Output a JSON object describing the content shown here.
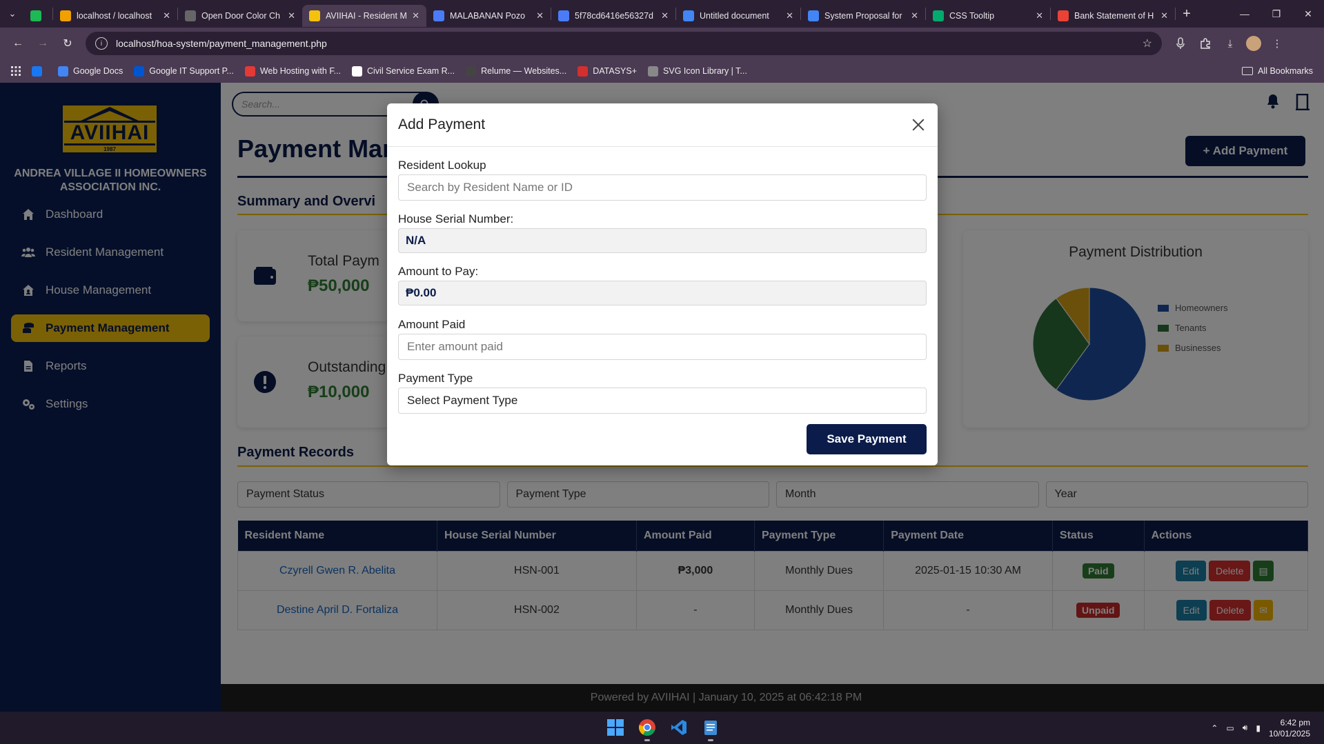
{
  "browser": {
    "tabs": [
      {
        "title": "",
        "favicon": "spotify-icon",
        "pinned": true,
        "color": "#1DB954"
      },
      {
        "title": "localhost / localhost",
        "favicon": "phpmyadmin-icon",
        "color": "#f0a000"
      },
      {
        "title": "Open Door Color Ch",
        "favicon": "globe-icon",
        "color": "#666666"
      },
      {
        "title": "AVIIHAI - Resident M",
        "favicon": "aviihai-icon",
        "color": "#f4c20d",
        "active": true
      },
      {
        "title": "MALABANAN Pozo",
        "favicon": "messenger-icon",
        "color": "#4a7cf7"
      },
      {
        "title": "5f78cd6416e56327d",
        "favicon": "cloud-icon",
        "color": "#4a7cf7"
      },
      {
        "title": "Untitled document",
        "favicon": "docs-icon",
        "color": "#4285f4"
      },
      {
        "title": "System Proposal for",
        "favicon": "docs-icon",
        "color": "#4285f4"
      },
      {
        "title": "CSS Tooltip",
        "favicon": "w3-icon",
        "color": "#04aa6d"
      },
      {
        "title": "Bank Statement of H",
        "favicon": "gmail-icon",
        "color": "#ea4335"
      }
    ],
    "url": "localhost/hoa-system/payment_management.php",
    "bookmarks": [
      {
        "label": "",
        "icon": "facebook-icon",
        "color": "#1877f2"
      },
      {
        "label": "Google Docs",
        "icon": "docs-icon",
        "color": "#4285f4"
      },
      {
        "label": "Google IT Support P...",
        "icon": "coursera-icon",
        "color": "#0056d2"
      },
      {
        "label": "Web Hosting with F...",
        "icon": "zeta-icon",
        "color": "#e53935"
      },
      {
        "label": "Civil Service Exam R...",
        "icon": "flag-icon",
        "color": "#ffffff"
      },
      {
        "label": "Relume — Websites...",
        "icon": "relume-icon",
        "color": "#444444"
      },
      {
        "label": "DATASYS+",
        "icon": "datasys-icon",
        "color": "#d32f2f"
      },
      {
        "label": "SVG Icon Library | T...",
        "icon": "svg-icon",
        "color": "#888888"
      }
    ],
    "all_bookmarks": "All Bookmarks"
  },
  "sidebar": {
    "logo_text": "AVIIHAI",
    "logo_year": "1987",
    "org_name": "ANDREA VILLAGE II HOMEOWNERS ASSOCIATION INC.",
    "items": [
      {
        "label": "Dashboard",
        "icon": "home-icon"
      },
      {
        "label": "Resident Management",
        "icon": "users-icon"
      },
      {
        "label": "House Management",
        "icon": "house-user-icon"
      },
      {
        "label": "Payment Management",
        "icon": "coins-icon",
        "active": true
      },
      {
        "label": "Reports",
        "icon": "file-icon"
      },
      {
        "label": "Settings",
        "icon": "gears-icon"
      }
    ]
  },
  "header": {
    "search_placeholder": "Search...",
    "page_title": "Payment Man",
    "add_button": "+ Add Payment"
  },
  "summary": {
    "title": "Summary and Overvi",
    "total_label": "Total Paym",
    "total_value": "₱50,000",
    "outstanding_label": "Outstanding",
    "outstanding_value": "₱10,000",
    "pie_title": "Payment Distribution"
  },
  "chart_data": {
    "type": "pie",
    "title": "Payment Distribution",
    "categories": [
      "Homeowners",
      "Tenants",
      "Businesses"
    ],
    "values": [
      60,
      30,
      10
    ],
    "colors": [
      "#1f4fa0",
      "#2f6e3a",
      "#d4a017"
    ],
    "legend": "right"
  },
  "records": {
    "title": "Payment Records",
    "filters": [
      "Payment Status",
      "Payment Type",
      "Month",
      "Year"
    ],
    "columns": [
      "Resident Name",
      "House Serial Number",
      "Amount Paid",
      "Payment Type",
      "Payment Date",
      "Status",
      "Actions"
    ],
    "rows": [
      {
        "name": "Czyrell Gwen R. Abelita",
        "serial": "HSN-001",
        "amount": "₱3,000",
        "type": "Monthly Dues",
        "date": "2025-01-15 10:30 AM",
        "status": "Paid"
      },
      {
        "name": "Destine April D. Fortaliza",
        "serial": "HSN-002",
        "amount": "-",
        "type": "Monthly Dues",
        "date": "-",
        "status": "Unpaid"
      }
    ],
    "edit_label": "Edit",
    "delete_label": "Delete"
  },
  "footer": {
    "text": "Powered by AVIIHAI | January 10, 2025 at 06:42:18 PM"
  },
  "modal": {
    "title": "Add Payment",
    "resident_label": "Resident Lookup",
    "resident_placeholder": "Search by Resident Name or ID",
    "serial_label": "House Serial Number:",
    "serial_value": "N/A",
    "amount_label": "Amount to Pay:",
    "amount_value": "₱0.00",
    "paid_label": "Amount Paid",
    "paid_placeholder": "Enter amount paid",
    "type_label": "Payment Type",
    "type_value": "Select Payment Type",
    "save_button": "Save Payment"
  },
  "taskbar": {
    "time": "6:42 pm",
    "date": "10/01/2025"
  }
}
